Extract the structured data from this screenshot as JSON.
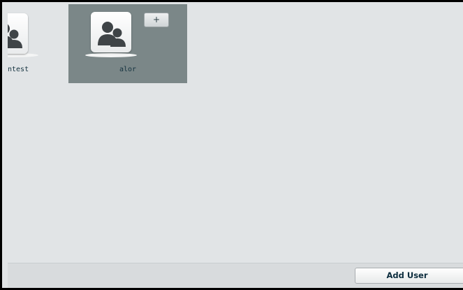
{
  "users": [
    {
      "name": "ntest",
      "icon": "user-group-icon"
    },
    {
      "name": "alor",
      "icon": "user-group-icon",
      "selected": true,
      "action_label": "+"
    }
  ],
  "footer": {
    "add_user_label": "Add User"
  },
  "colors": {
    "panel_bg": "#e1e4e6",
    "selected_tile": "#7b8788",
    "text": "#14323f"
  }
}
